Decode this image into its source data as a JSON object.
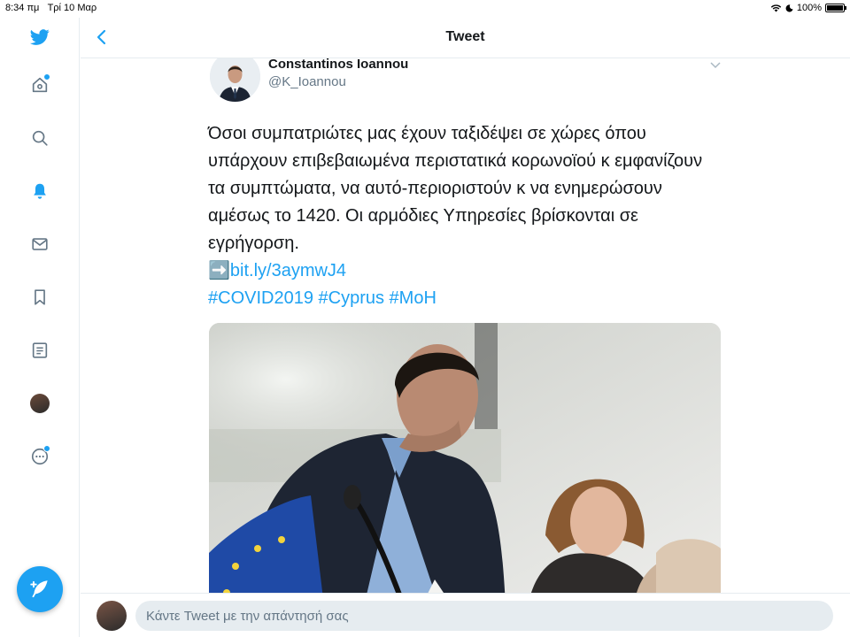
{
  "status_bar": {
    "time": "8:34 πμ",
    "date": "Τρί 10 Μαρ",
    "battery": "100%",
    "battery_level": 1.0
  },
  "sidebar": {
    "items": [
      {
        "icon": "twitter-logo-icon"
      },
      {
        "icon": "home-icon",
        "badge": true
      },
      {
        "icon": "search-icon"
      },
      {
        "icon": "notifications-bell-icon",
        "active": true
      },
      {
        "icon": "messages-icon"
      },
      {
        "icon": "bookmark-icon"
      },
      {
        "icon": "lists-icon"
      },
      {
        "icon": "profile-avatar"
      },
      {
        "icon": "more-icon",
        "badge": true
      }
    ],
    "compose_icon": "compose-feather-icon"
  },
  "header": {
    "title": "Tweet",
    "back_icon": "chevron-left-icon"
  },
  "tweet": {
    "author_name": "Constantinos Ioannou",
    "author_handle": "@K_Ioannou",
    "text": "Όσοι συμπατριώτες μας έχουν ταξιδέψει σε χώρες όπου υπάρχουν επιβεβαιωμένα περιστατικά κορωνοϊού κ εμφανίζουν τα συμπτώματα, να αυτό-περιοριστούν κ να ενημερώσουν αμέσως το 1420. Οι αρμόδιες Υπηρεσίες βρίσκονται σε εγρήγορση.",
    "link_emoji": "➡️",
    "link": "bit.ly/3aymwJ4",
    "hashtags": "#COVID2019 #Cyprus #MoH"
  },
  "reply": {
    "placeholder": "Κάντε Tweet με την απάντησή σας"
  },
  "colors": {
    "accent": "#1da1f2",
    "border": "#e6ecf0",
    "muted": "#657786"
  }
}
